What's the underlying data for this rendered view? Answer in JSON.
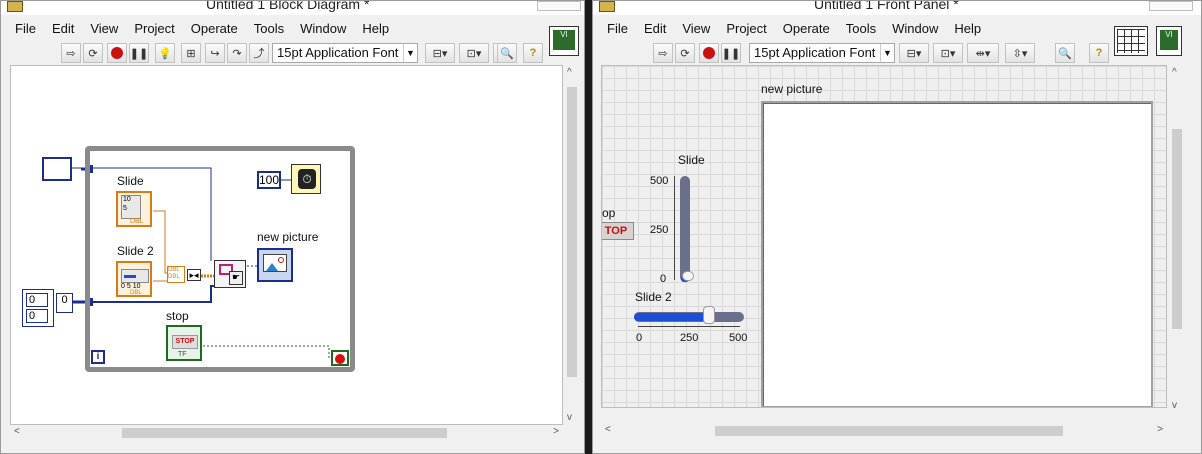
{
  "block_diagram": {
    "title": "Untitled 1 Block Diagram *",
    "menu": [
      "File",
      "Edit",
      "View",
      "Project",
      "Operate",
      "Tools",
      "Window",
      "Help"
    ],
    "font": "15pt Application Font",
    "labels": {
      "slide": "Slide",
      "slide2": "Slide 2",
      "new_picture": "new picture",
      "stop": "stop"
    },
    "wait_value": "100",
    "array_values": [
      "0",
      "0"
    ],
    "index_value": "0",
    "loop_index": "i",
    "slide_terminal": "DBL",
    "slide_scale": [
      "10",
      "5",
      "0"
    ],
    "slide2_scale": [
      "0",
      "5",
      "10"
    ],
    "stop_terminal": "STOP",
    "bool_type": "TF",
    "bundle_types": [
      "DBL",
      "DBL"
    ]
  },
  "front_panel": {
    "title": "Untitled 1 Front Panel *",
    "menu": [
      "File",
      "Edit",
      "View",
      "Project",
      "Operate",
      "Tools",
      "Window",
      "Help"
    ],
    "font": "15pt Application Font",
    "slide_label": "Slide",
    "slide_ticks": [
      "500",
      "250",
      "0"
    ],
    "slide2_label": "Slide 2",
    "slide2_ticks": [
      "0",
      "250",
      "500"
    ],
    "stop_label": "op",
    "stop_button": "TOP",
    "picture_label": "new picture",
    "slide_value": 0.0,
    "slide2_value": 0.68
  },
  "colors": {
    "wire_blue": "#1b2e8e",
    "wire_orange": "#d67b18",
    "wire_green": "#1e6b1e",
    "slider_blue": "#1c4ed8"
  }
}
